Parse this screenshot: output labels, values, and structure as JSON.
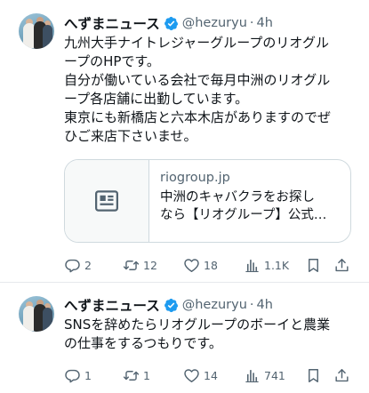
{
  "tweets": [
    {
      "author": {
        "name": "へずまニュース",
        "handle": "@hezuryu",
        "separator": "·",
        "time": "4h"
      },
      "text": "九州大手ナイトレジャーグループのリオグル\nープのHPです。\n自分が働いている会社で毎月中洲のリオグル\nープ各店舗に出勤しています。\n東京にも新橋店と六本木店がありますのでぜ\nひご来店下さいませ。",
      "card": {
        "domain": "riogroup.jp",
        "description": "中洲のキャバクラをお探し\nなら【リオグループ】公式…"
      },
      "stats": {
        "replies": "2",
        "reposts": "12",
        "likes": "18",
        "views": "1.1K"
      }
    },
    {
      "author": {
        "name": "へずまニュース",
        "handle": "@hezuryu",
        "separator": "·",
        "time": "4h"
      },
      "text": "SNSを辞めたらリオグループのボーイと農業\nの仕事をするつもりです。",
      "stats": {
        "replies": "1",
        "reposts": "1",
        "likes": "14",
        "views": "741"
      }
    }
  ],
  "icons": {
    "verified": "verified-badge-icon",
    "reply": "reply-icon",
    "repost": "repost-icon",
    "like": "like-icon",
    "views": "views-icon",
    "bookmark": "bookmark-icon",
    "share": "share-icon",
    "card_media": "article-icon"
  },
  "colors": {
    "verified": "#1d9bf0",
    "secondary_text": "#536471",
    "primary_text": "#0f1419",
    "border": "#cfd9de"
  }
}
